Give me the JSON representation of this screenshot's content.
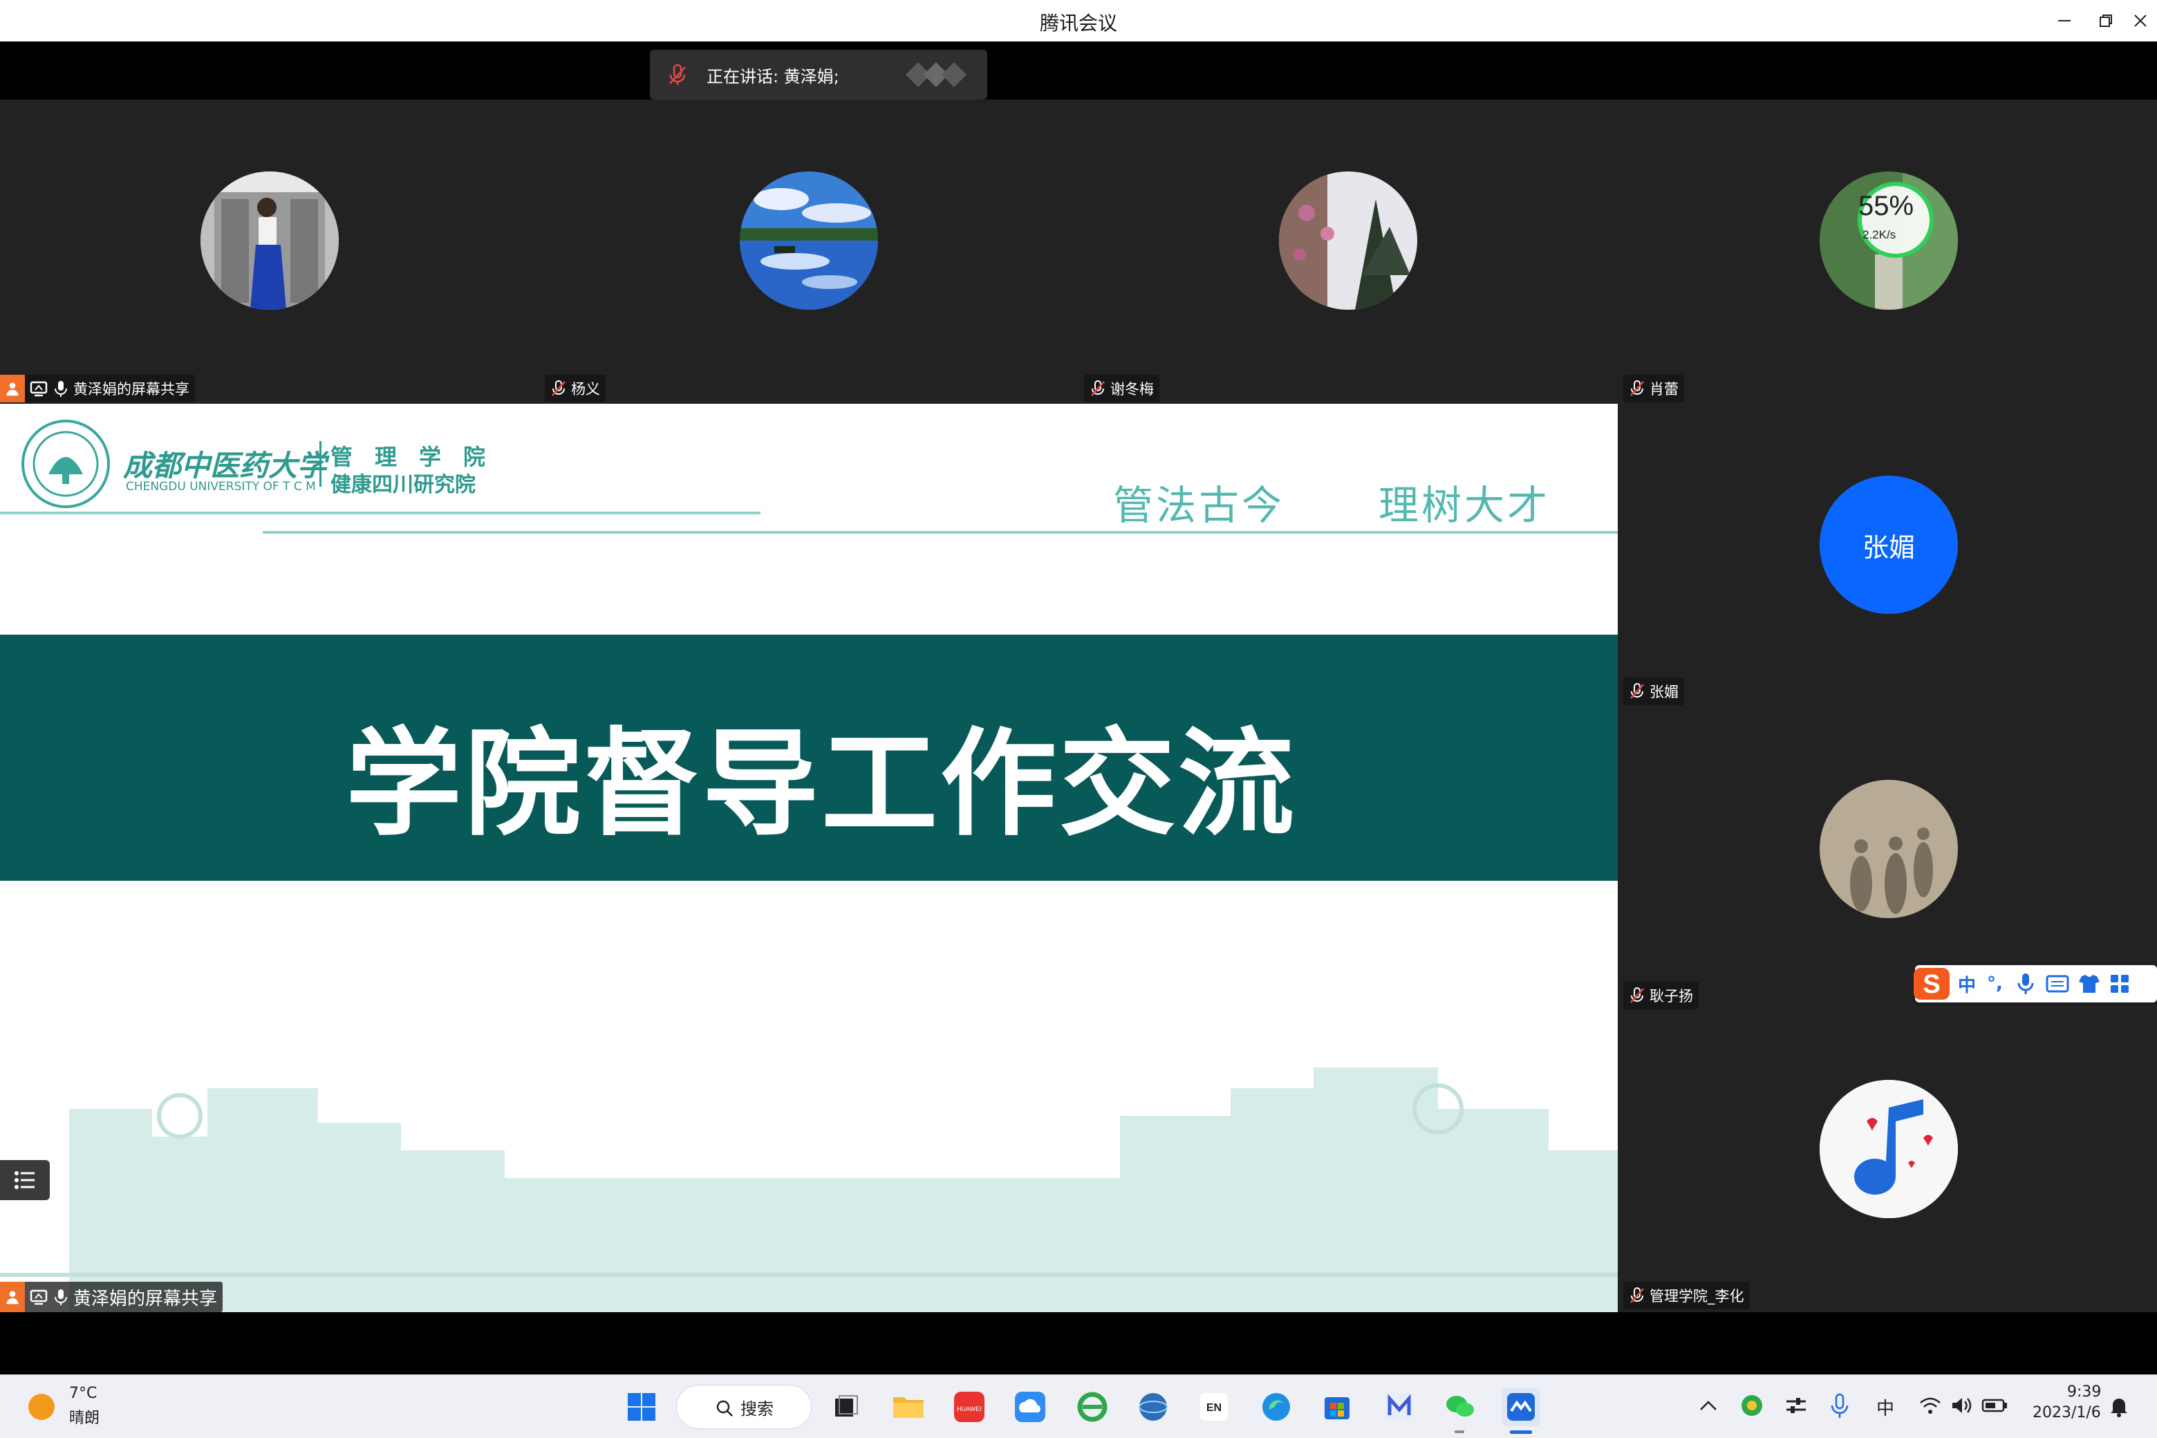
{
  "window": {
    "title": "腾讯会议",
    "controls": [
      "minimize",
      "restore",
      "close"
    ]
  },
  "speaking_banner": {
    "label": "正在讲话: 黄泽娟;"
  },
  "participants_top": [
    {
      "name": "黄泽娟的屏幕共享",
      "host": true,
      "mic": "on"
    },
    {
      "name": "杨义",
      "mic": "muted"
    },
    {
      "name": "谢冬梅",
      "mic": "muted"
    },
    {
      "name": "肖蕾",
      "mic": "muted",
      "network_overlay": {
        "percent": "55%",
        "speed": "2.2K/s"
      }
    }
  ],
  "participants_right": [
    {
      "name": "张媚",
      "avatar_text": "张媚",
      "mic": "muted"
    },
    {
      "name": "耿子扬",
      "mic": "muted"
    },
    {
      "name": "管理学院_李化",
      "mic": "muted"
    }
  ],
  "shared_slide": {
    "logo_cn": "成都中医药大学",
    "logo_en": "CHENGDU UNIVERSITY OF T C M",
    "dept_line1": "管　理　学　院",
    "dept_line2": "健康四川研究院",
    "slogan_left": "管法古今",
    "slogan_right": "理树大才",
    "heading": "学院督导工作交流",
    "presenter_label": "黄泽娟的屏幕共享"
  },
  "ime": {
    "mode": "中",
    "punct": "°,",
    "icons": [
      "mic-icon",
      "keyboard-icon",
      "skin-icon",
      "toolbox-icon"
    ]
  },
  "taskbar": {
    "weather_temp": "7°C",
    "weather_desc": "晴朗",
    "search_label": "搜索",
    "lang": "EN",
    "ime_tray": "中",
    "time": "9:39",
    "date": "2023/1/6"
  },
  "colors": {
    "slide_band": "#075a57",
    "slide_accent": "#55b8b0",
    "avatar_blue": "#0a66ff",
    "host_orange": "#f0702a"
  }
}
